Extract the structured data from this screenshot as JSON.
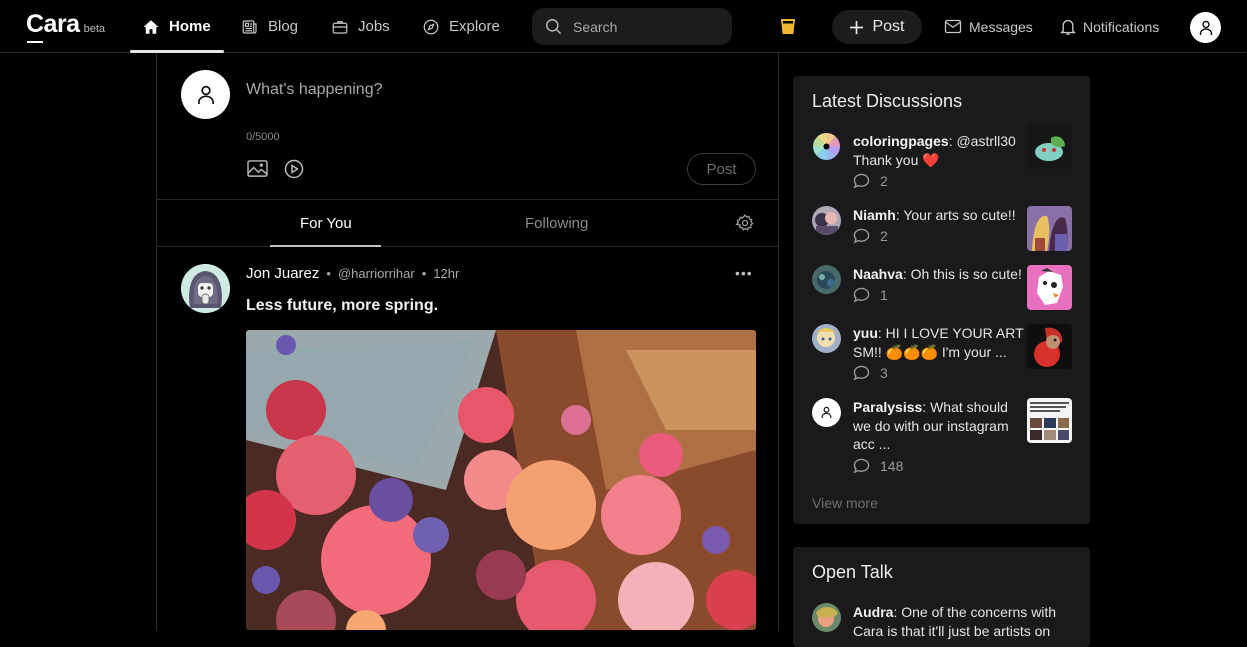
{
  "header": {
    "logo": "Cara",
    "logo_badge": "beta",
    "nav": [
      {
        "label": "Home",
        "icon": "home-icon",
        "active": true
      },
      {
        "label": "Blog",
        "icon": "newspaper-icon",
        "active": false
      },
      {
        "label": "Jobs",
        "icon": "briefcase-icon",
        "active": false
      },
      {
        "label": "Explore",
        "icon": "compass-icon",
        "active": false
      }
    ],
    "search_placeholder": "Search",
    "post_button": "Post",
    "messages": "Messages",
    "notifications": "Notifications",
    "accent_color": "#f2b630"
  },
  "composer": {
    "placeholder": "What's happening?",
    "counter": "0/5000",
    "post_button": "Post"
  },
  "tabs": [
    {
      "label": "For You",
      "active": true
    },
    {
      "label": "Following",
      "active": false
    }
  ],
  "post": {
    "author": "Jon Juarez",
    "handle": "@harriorrihar",
    "time": "12hr",
    "separator": "•",
    "text": "Less future, more spring.",
    "more": "•••"
  },
  "latest_discussions": {
    "title": "Latest Discussions",
    "items": [
      {
        "user": "coloringpages",
        "text": ": @astrll30 Thank you ❤️",
        "comments": "2"
      },
      {
        "user": "Niamh",
        "text": ": Your arts so cute!!",
        "comments": "2"
      },
      {
        "user": "Naahva",
        "text": ": Oh this is so cute!",
        "comments": "1"
      },
      {
        "user": "yuu",
        "text": ": HI I LOVE YOUR ART SM!! 🍊🍊🍊 I'm your ...",
        "comments": "3"
      },
      {
        "user": "Paralysiss",
        "text": ": What should we do with our instagram acc ...",
        "comments": "148"
      }
    ],
    "view_more": "View more"
  },
  "open_talk": {
    "title": "Open Talk",
    "items": [
      {
        "user": "Audra",
        "text": ": One of the concerns with Cara is that it'll just be artists on"
      }
    ]
  }
}
